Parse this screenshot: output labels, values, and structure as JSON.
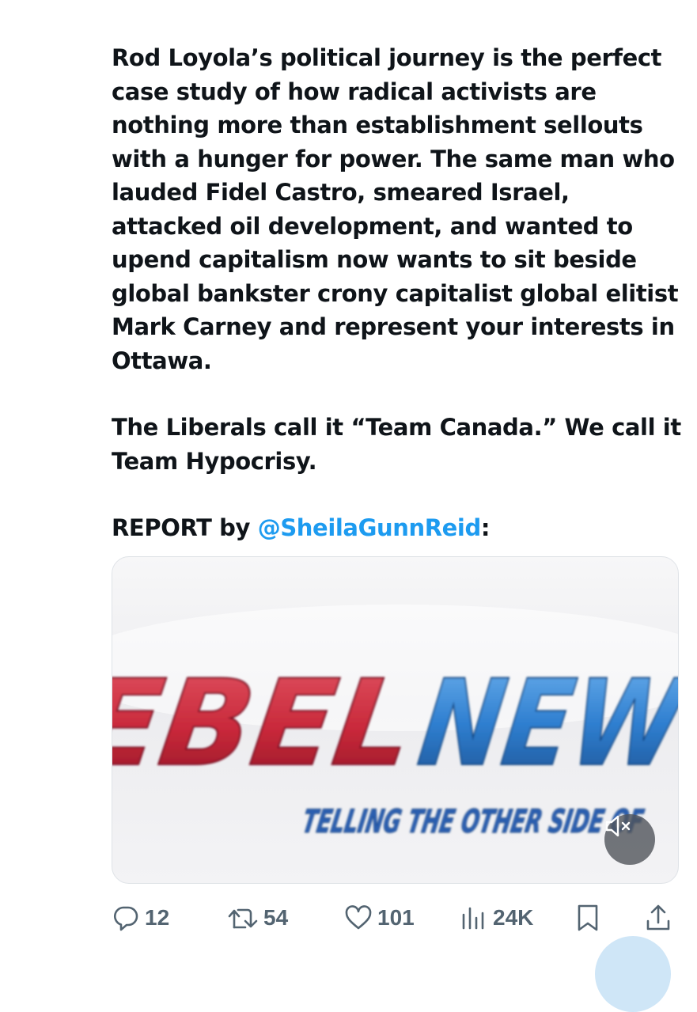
{
  "tweet": {
    "paragraph1": "Rod Loyola’s political journey is the perfect case study of how radical activists are nothing more than establishment sellouts with a hunger for power. The same man who lauded Fidel Castro, smeared Israel, attacked oil development, and wanted to upend capitalism now wants to sit beside global bankster crony capitalist global elitist Mark Carney and represent your interests in Ottawa.",
    "paragraph2": "The Liberals call it “Team Canada.” We call it Team Hypocrisy.",
    "report_prefix": "REPORT by ",
    "mention": "@SheilaGunnReid",
    "report_suffix": ":"
  },
  "media": {
    "logo_red": "EBEL",
    "logo_blue": "NEW",
    "tagline": "TELLING THE OTHER SIDE OF",
    "mute_icon": "speaker-muted-icon"
  },
  "actions": {
    "replies": "12",
    "reposts": "54",
    "likes": "101",
    "views": "24K"
  },
  "colors": {
    "text": "#0f1419",
    "mention": "#1d9bf0",
    "action_gray": "#536471",
    "logo_red": "#c8283a",
    "logo_blue": "#2f7fd0",
    "tagline_blue": "#2a5fb0"
  }
}
